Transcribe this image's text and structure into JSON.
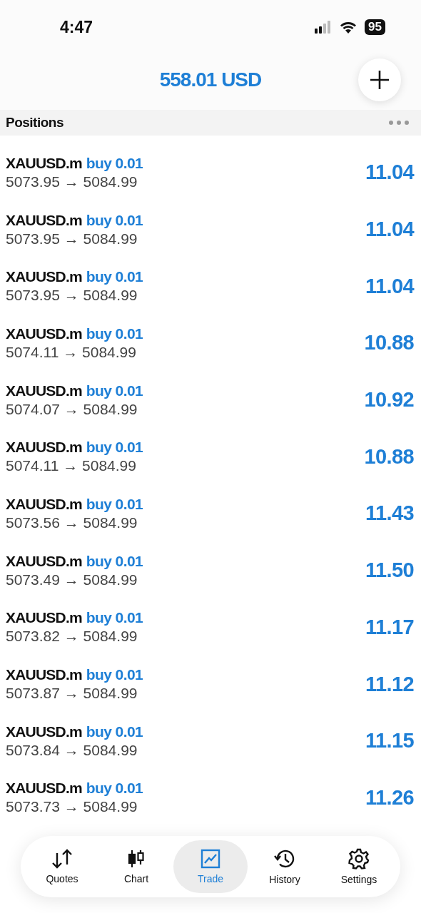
{
  "status_bar": {
    "time": "4:47",
    "battery": "95"
  },
  "header": {
    "balance": "558.01 USD"
  },
  "section": {
    "title": "Positions"
  },
  "positions": [
    {
      "symbol": "XAUUSD.m",
      "order": "buy 0.01",
      "prices": "5073.95 → 5084.99",
      "profit": "11.04"
    },
    {
      "symbol": "XAUUSD.m",
      "order": "buy 0.01",
      "prices": "5073.95 → 5084.99",
      "profit": "11.04"
    },
    {
      "symbol": "XAUUSD.m",
      "order": "buy 0.01",
      "prices": "5073.95 → 5084.99",
      "profit": "11.04"
    },
    {
      "symbol": "XAUUSD.m",
      "order": "buy 0.01",
      "prices": "5074.11 → 5084.99",
      "profit": "10.88"
    },
    {
      "symbol": "XAUUSD.m",
      "order": "buy 0.01",
      "prices": "5074.07 → 5084.99",
      "profit": "10.92"
    },
    {
      "symbol": "XAUUSD.m",
      "order": "buy 0.01",
      "prices": "5074.11 → 5084.99",
      "profit": "10.88"
    },
    {
      "symbol": "XAUUSD.m",
      "order": "buy 0.01",
      "prices": "5073.56 → 5084.99",
      "profit": "11.43"
    },
    {
      "symbol": "XAUUSD.m",
      "order": "buy 0.01",
      "prices": "5073.49 → 5084.99",
      "profit": "11.50"
    },
    {
      "symbol": "XAUUSD.m",
      "order": "buy 0.01",
      "prices": "5073.82 → 5084.99",
      "profit": "11.17"
    },
    {
      "symbol": "XAUUSD.m",
      "order": "buy 0.01",
      "prices": "5073.87 → 5084.99",
      "profit": "11.12"
    },
    {
      "symbol": "XAUUSD.m",
      "order": "buy 0.01",
      "prices": "5073.84 → 5084.99",
      "profit": "11.15"
    },
    {
      "symbol": "XAUUSD.m",
      "order": "buy 0.01",
      "prices": "5073.73 → 5084.99",
      "profit": "11.26"
    }
  ],
  "tabs": [
    {
      "label": "Quotes",
      "kind": "quotes",
      "selected": false
    },
    {
      "label": "Chart",
      "kind": "chart",
      "selected": false
    },
    {
      "label": "Trade",
      "kind": "trade",
      "selected": true
    },
    {
      "label": "History",
      "kind": "history",
      "selected": false
    },
    {
      "label": "Settings",
      "kind": "settings",
      "selected": false
    }
  ]
}
